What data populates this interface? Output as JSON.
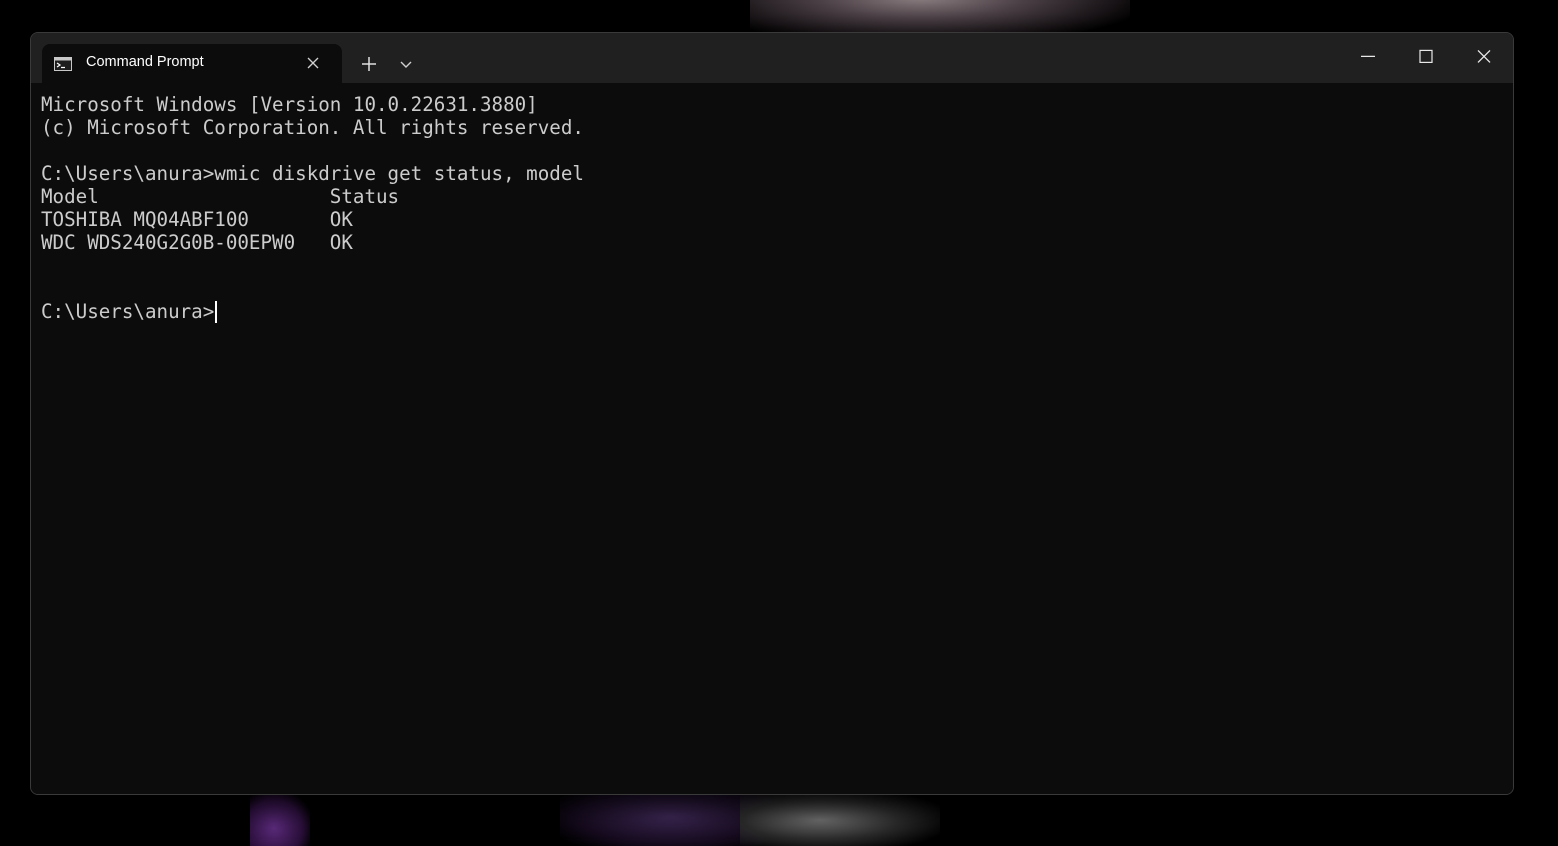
{
  "wallpaper": {
    "colors": [
      "#8a7d80",
      "#5a2a7a",
      "#3a2550",
      "#6a6a6a"
    ]
  },
  "window": {
    "tab": {
      "title": "Command Prompt",
      "icon": "command-prompt-icon",
      "close_icon": "close-icon"
    },
    "new_tab_icon": "plus-icon",
    "dropdown_icon": "chevron-down-icon",
    "controls": {
      "minimize_icon": "minimize-icon",
      "maximize_icon": "maximize-icon",
      "close_icon": "close-icon"
    }
  },
  "terminal": {
    "colors": {
      "background": "#0c0c0c",
      "foreground": "#cccccc"
    },
    "lines": [
      "Microsoft Windows [Version 10.0.22631.3880]",
      "(c) Microsoft Corporation. All rights reserved.",
      "",
      "C:\\Users\\anura>wmic diskdrive get status, model",
      "Model                    Status",
      "TOSHIBA MQ04ABF100       OK",
      "WDC WDS240G2G0B-00EPW0   OK",
      "",
      ""
    ],
    "prompt": "C:\\Users\\anura>"
  }
}
